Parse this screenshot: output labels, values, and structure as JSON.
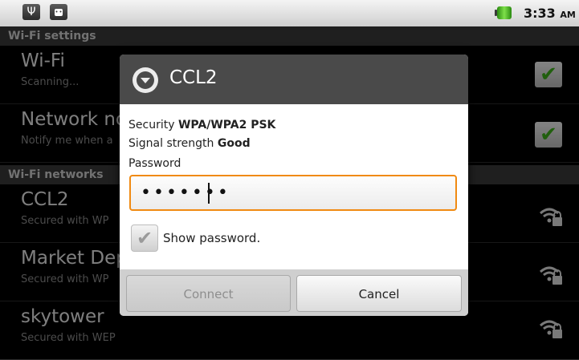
{
  "status_bar": {
    "time": "3:33",
    "ampm": "AM",
    "icons": [
      "usb-icon",
      "android-debug-icon"
    ],
    "battery_level": 1.0
  },
  "sections": {
    "wifi_settings": "Wi-Fi settings",
    "wifi_networks": "Wi-Fi networks"
  },
  "rows": [
    {
      "title": "Wi-Fi",
      "subtitle": "Scanning...",
      "checked": true
    },
    {
      "title": "Network no",
      "subtitle": "Notify me when a",
      "checked": true
    },
    {
      "title": "CCL2",
      "subtitle": "Secured with WP"
    },
    {
      "title": "Market Dep",
      "subtitle": "Secured with WP"
    },
    {
      "title": "skytower",
      "subtitle": "Secured with WEP"
    }
  ],
  "dialog": {
    "title": "CCL2",
    "security_label": "Security",
    "security_value": "WPA/WPA2 PSK",
    "signal_label": "Signal strength",
    "signal_value": "Good",
    "password_label": "Password",
    "password_value": "•••••••",
    "show_password_label": "Show password.",
    "show_password_checked": false,
    "connect_label": "Connect",
    "cancel_label": "Cancel"
  },
  "colors": {
    "accent_orange": "#f08a12",
    "check_green": "#3cae1a",
    "header_gray": "#4a4a4a"
  }
}
